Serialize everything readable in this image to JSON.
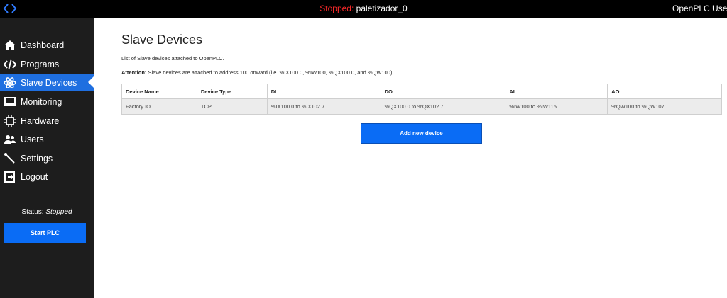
{
  "topbar": {
    "status_word": "Stopped:",
    "program": "paletizador_0",
    "user": "OpenPLC User"
  },
  "sidebar": {
    "items": [
      {
        "label": "Dashboard",
        "icon": "home-icon"
      },
      {
        "label": "Programs",
        "icon": "code-icon"
      },
      {
        "label": "Slave Devices",
        "icon": "atom-icon"
      },
      {
        "label": "Monitoring",
        "icon": "monitor-icon"
      },
      {
        "label": "Hardware",
        "icon": "chip-icon"
      },
      {
        "label": "Users",
        "icon": "users-icon"
      },
      {
        "label": "Settings",
        "icon": "wrench-icon"
      },
      {
        "label": "Logout",
        "icon": "logout-icon"
      }
    ],
    "status_label": "Status:",
    "status_value": "Stopped",
    "start_button": "Start PLC"
  },
  "main": {
    "title": "Slave Devices",
    "description": "List of Slave devices attached to OpenPLC.",
    "attention_label": "Attention:",
    "attention_text": "Slave devices are attached to address 100 onward (i.e. %IX100.0, %IW100, %QX100.0, and %QW100)",
    "table": {
      "headers": [
        "Device Name",
        "Device Type",
        "DI",
        "DO",
        "AI",
        "AO"
      ],
      "rows": [
        [
          "Factory IO",
          "TCP",
          "%IX100.0 to %IX102.7",
          "%QX100.0 to %QX102.7",
          "%IW100 to %IW115",
          "%QW100 to %QW107"
        ]
      ]
    },
    "add_button": "Add new device"
  },
  "colors": {
    "accent": "#1f6fe0",
    "button": "#0a6cf5",
    "sidebar": "#1d1d1d",
    "stopped": "#ff2a2a"
  }
}
